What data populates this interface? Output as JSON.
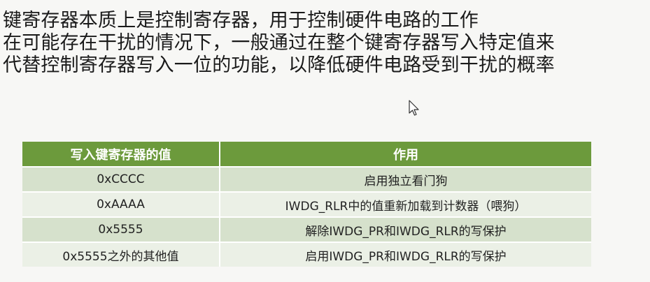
{
  "paragraph": {
    "lines": [
      "键寄存器本质上是控制寄存器，用于控制硬件电路的工作",
      "在可能存在干扰的情况下，一般通过在整个键寄存器写入特定值来",
      "代替控制寄存器写入一位的功能，以降低硬件电路受到干扰的概率"
    ]
  },
  "table": {
    "headers": [
      "写入键寄存器的值",
      "作用"
    ],
    "rows": [
      [
        "0xCCCC",
        "启用独立看门狗"
      ],
      [
        "0xAAAA",
        "IWDG_RLR中的值重新加载到计数器（喂狗）"
      ],
      [
        "0x5555",
        "解除IWDG_PR和IWDG_RLR的写保护"
      ],
      [
        "0x5555之外的其他值",
        "启用IWDG_PR和IWDG_RLR的写保护"
      ]
    ]
  },
  "colors": {
    "header_bg": "#6c9a3c",
    "row_odd_bg": "#d6e1cc",
    "row_even_bg": "#ebf0e6"
  },
  "icons": {
    "cursor": "mouse-pointer-icon"
  }
}
